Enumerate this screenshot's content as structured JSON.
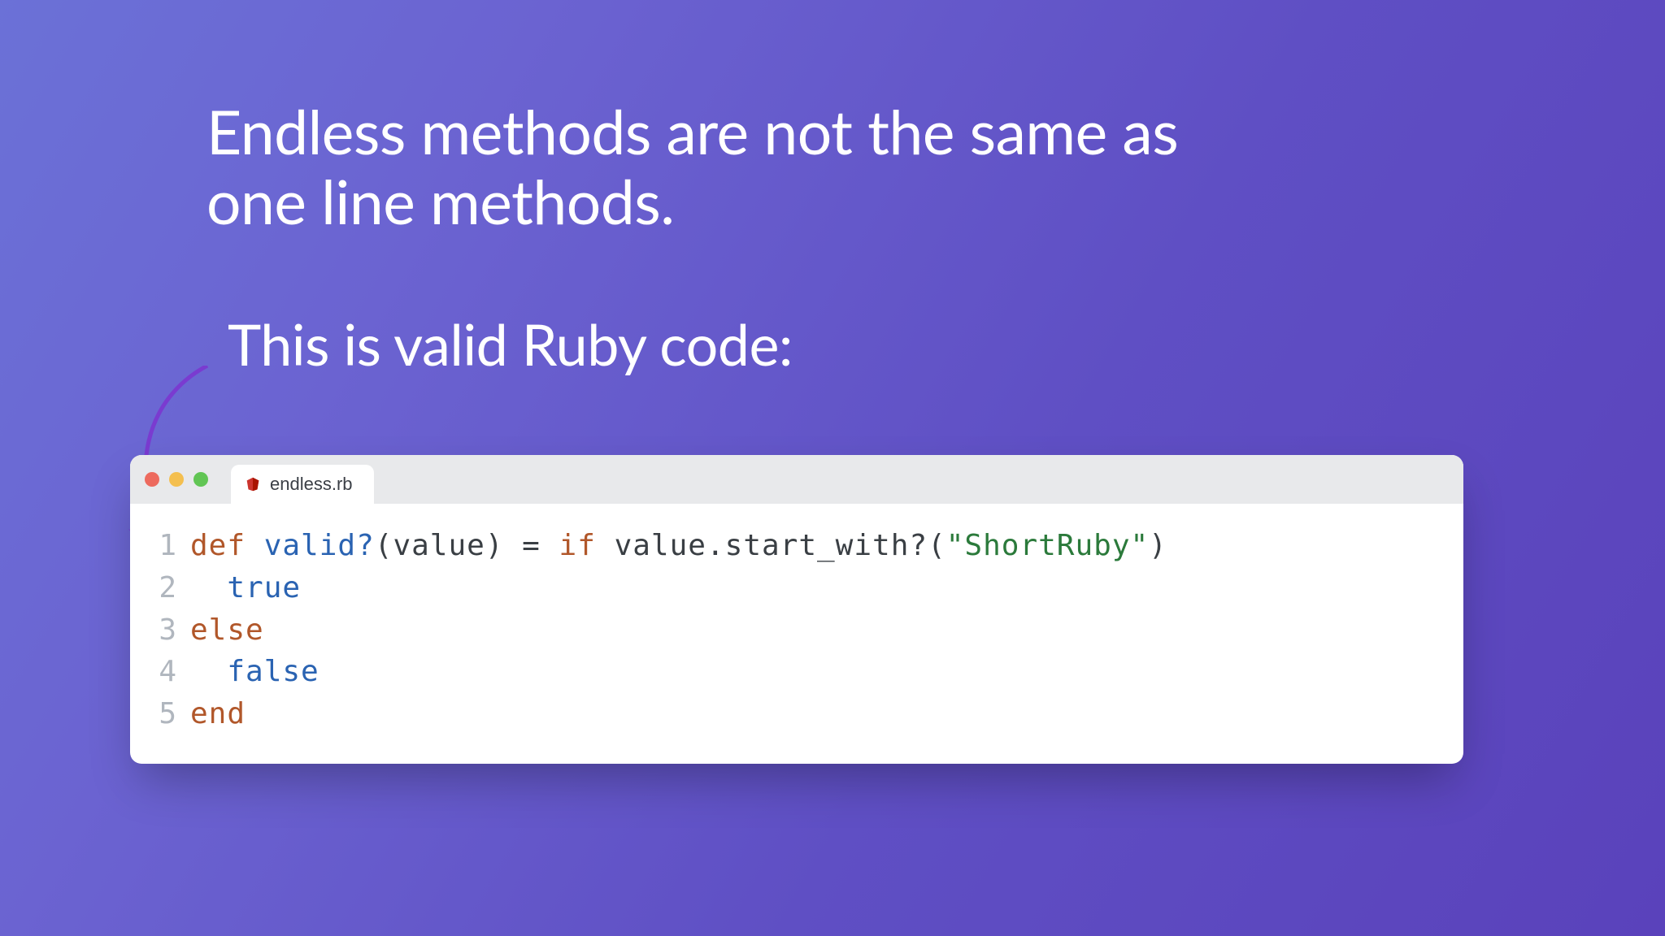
{
  "headline_line1": "Endless methods are not the same as",
  "headline_line2": "one line methods.",
  "subhead": "This is valid Ruby code:",
  "editor": {
    "tab_filename": "endless.rb",
    "tab_icon": "ruby-icon"
  },
  "code": {
    "lines": [
      {
        "n": "1",
        "tokens": [
          {
            "t": "def ",
            "c": "tok-kw"
          },
          {
            "t": "valid?",
            "c": "tok-fn"
          },
          {
            "t": "(",
            "c": "tok-punc"
          },
          {
            "t": "value",
            "c": "tok-id"
          },
          {
            "t": ") ",
            "c": "tok-punc"
          },
          {
            "t": "=",
            "c": "tok-punc"
          },
          {
            "t": " ",
            "c": "tok-punc"
          },
          {
            "t": "if ",
            "c": "tok-kw"
          },
          {
            "t": "value",
            "c": "tok-id"
          },
          {
            "t": ".",
            "c": "tok-punc"
          },
          {
            "t": "start_with?",
            "c": "tok-id"
          },
          {
            "t": "(",
            "c": "tok-punc"
          },
          {
            "t": "\"ShortRuby\"",
            "c": "tok-str"
          },
          {
            "t": ")",
            "c": "tok-punc"
          }
        ]
      },
      {
        "n": "2",
        "tokens": [
          {
            "t": "  ",
            "c": "tok-punc"
          },
          {
            "t": "true",
            "c": "tok-bool"
          }
        ]
      },
      {
        "n": "3",
        "tokens": [
          {
            "t": "else",
            "c": "tok-kw"
          }
        ]
      },
      {
        "n": "4",
        "tokens": [
          {
            "t": "  ",
            "c": "tok-punc"
          },
          {
            "t": "false",
            "c": "tok-bool"
          }
        ]
      },
      {
        "n": "5",
        "tokens": [
          {
            "t": "end",
            "c": "tok-kw"
          }
        ]
      }
    ]
  },
  "colors": {
    "gradient_start": "#6b71d7",
    "gradient_end": "#5a42bb",
    "arrow": "#7a3bd0"
  }
}
